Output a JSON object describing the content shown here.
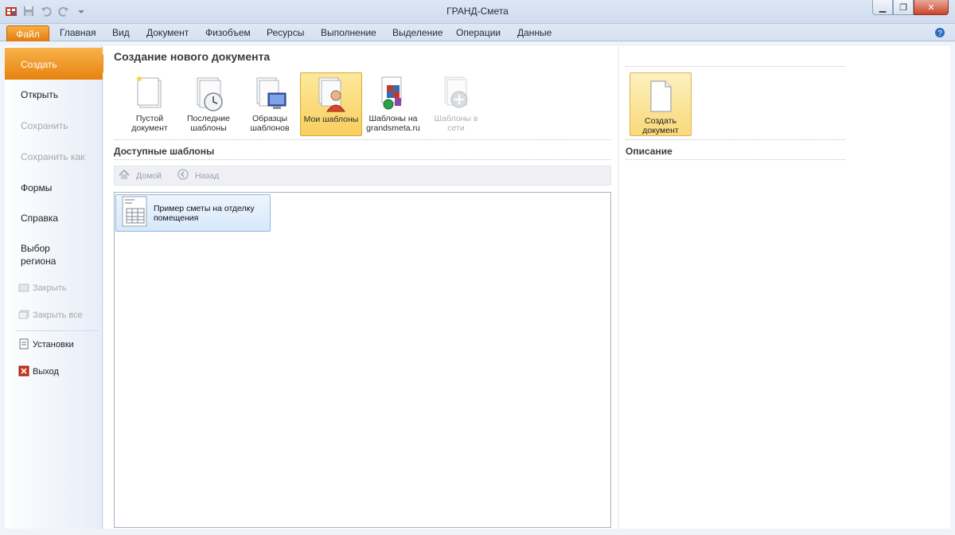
{
  "window": {
    "title": "ГРАНД-Смета"
  },
  "ribbon": {
    "tabs": [
      "Файл",
      "Главная",
      "Вид",
      "Документ",
      "Физобъем",
      "Ресурсы",
      "Выполнение",
      "Выделение",
      "Операции",
      "Данные"
    ]
  },
  "nav": {
    "items": [
      {
        "label": "Создать"
      },
      {
        "label": "Открыть"
      },
      {
        "label": "Сохранить"
      },
      {
        "label": "Сохранить как"
      },
      {
        "label": "Формы"
      },
      {
        "label": "Справка"
      },
      {
        "label": "Выбор региона"
      },
      {
        "label": "Закрыть"
      },
      {
        "label": "Закрыть все"
      },
      {
        "label": "Установки"
      },
      {
        "label": "Выход"
      }
    ]
  },
  "main": {
    "title": "Создание нового документа",
    "template_types": [
      {
        "label": "Пустой документ",
        "icon": "blank-document-icon"
      },
      {
        "label": "Последние шаблоны",
        "icon": "recent-templates-icon"
      },
      {
        "label": "Образцы шаблонов",
        "icon": "sample-templates-icon"
      },
      {
        "label": "Мои шаблоны",
        "icon": "my-templates-icon"
      },
      {
        "label": "Шаблоны на grandsmeta.ru",
        "icon": "web-templates-icon"
      },
      {
        "label": "Шаблоны в сети",
        "icon": "network-templates-icon"
      }
    ],
    "available_title": "Доступные шаблоны",
    "path": {
      "home": "Домой",
      "back": "Назад"
    },
    "templates": [
      {
        "label": "Пример сметы на отделку помещения"
      }
    ]
  },
  "side": {
    "create_label": "Создать документ",
    "description_title": "Описание"
  }
}
